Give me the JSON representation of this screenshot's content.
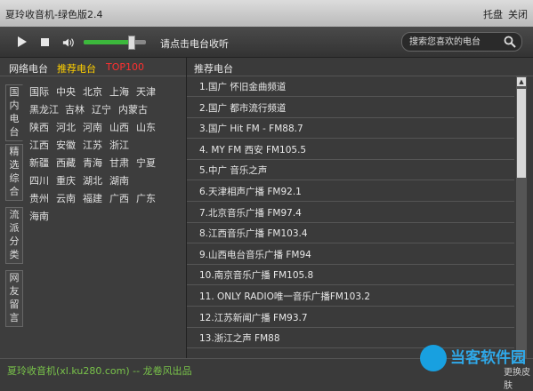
{
  "titlebar": {
    "title": "夏玲收音机-绿色版2.4",
    "tray": "托盘",
    "close": "关闭"
  },
  "toolbar": {
    "status": "请点击电台收听",
    "search_placeholder": "搜索您喜欢的电台",
    "volume_level": 0.75
  },
  "left": {
    "tabs": [
      "网络电台",
      "推荐电台",
      "TOP100"
    ],
    "vtabs": [
      "国内电台",
      "精选综合",
      "流派分类",
      "网友留言"
    ],
    "regions": [
      "国际",
      "中央",
      "北京",
      "上海",
      "天津",
      "黑龙江",
      "吉林",
      "辽宁",
      "内蒙古",
      "陕西",
      "河北",
      "河南",
      "山西",
      "山东",
      "江西",
      "安徽",
      "江苏",
      "浙江",
      "新疆",
      "西藏",
      "青海",
      "甘肃",
      "宁夏",
      "四川",
      "重庆",
      "湖北",
      "湖南",
      "贵州",
      "云南",
      "福建",
      "广西",
      "广东",
      "海南"
    ]
  },
  "right": {
    "header": "推荐电台",
    "stations": [
      "1.国广  怀旧金曲频道",
      "2.国广  都市流行频道",
      "3.国广  Hit FM - FM88.7",
      "4. MY FM 西安  FM105.5",
      "5.中广  音乐之声",
      "6.天津相声广播  FM92.1",
      "7.北京音乐广播  FM97.4",
      "8.江西音乐广播  FM103.4",
      "9.山西电台音乐广播  FM94",
      "10.南京音乐广播  FM105.8",
      "11. ONLY RADIO唯一音乐广播FM103.2",
      "12.江苏新闻广播  FM93.7",
      "13.浙江之声  FM88"
    ]
  },
  "bottom": {
    "credit": "夏玲收音机(xl.ku280.com)  --  龙卷风出品",
    "skin": "更换皮肤"
  },
  "watermark": {
    "text": "当客软件园"
  },
  "colors": {
    "accent_green": "#3cb83c",
    "active_tab": "#ffd000",
    "top100": "#ff3030",
    "credit": "#79c34a"
  }
}
